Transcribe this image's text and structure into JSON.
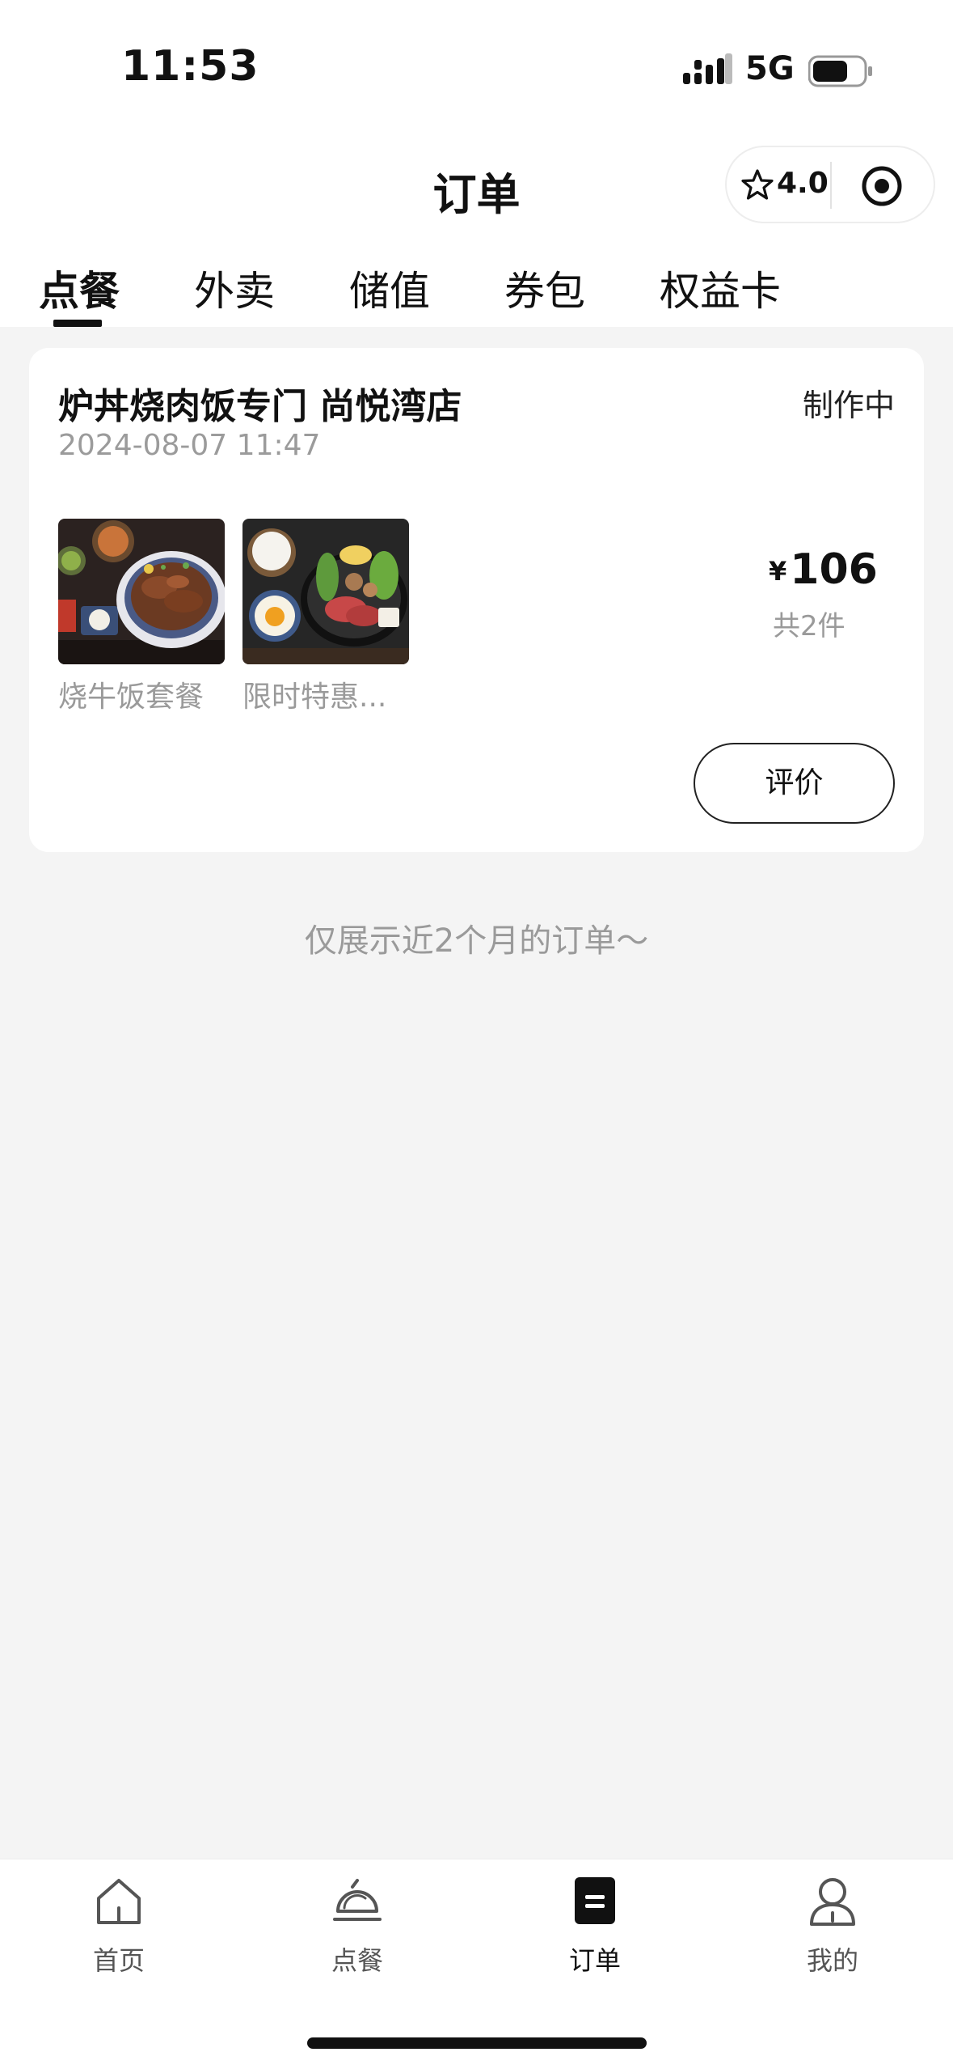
{
  "status_bar": {
    "time": "11:53",
    "network": "5G"
  },
  "header": {
    "title": "订单",
    "rating": "4.0"
  },
  "tabs": [
    {
      "label": "点餐",
      "active": true
    },
    {
      "label": "外卖",
      "active": false
    },
    {
      "label": "储值",
      "active": false
    },
    {
      "label": "券包",
      "active": false
    },
    {
      "label": "权益卡",
      "active": false
    }
  ],
  "order": {
    "store_name": "炉丼烧肉饭专门 尚悦湾店",
    "status": "制作中",
    "datetime": "2024-08-07 11:47",
    "items": [
      {
        "name": "烧牛饭套餐"
      },
      {
        "name": "限时特惠..."
      }
    ],
    "currency": "¥",
    "total": "106",
    "count_label": "共2件",
    "review_label": "评价"
  },
  "footer_note": "仅展示近2个月的订单～",
  "tabbar": [
    {
      "label": "首页",
      "icon": "home-icon",
      "active": false
    },
    {
      "label": "点餐",
      "icon": "cloche-icon",
      "active": false
    },
    {
      "label": "订单",
      "icon": "order-list-icon",
      "active": true
    },
    {
      "label": "我的",
      "icon": "user-icon",
      "active": false
    }
  ],
  "colors": {
    "background": "#f4f4f4",
    "card": "#ffffff",
    "text_primary": "#111111",
    "text_secondary": "#9a9a9a"
  }
}
